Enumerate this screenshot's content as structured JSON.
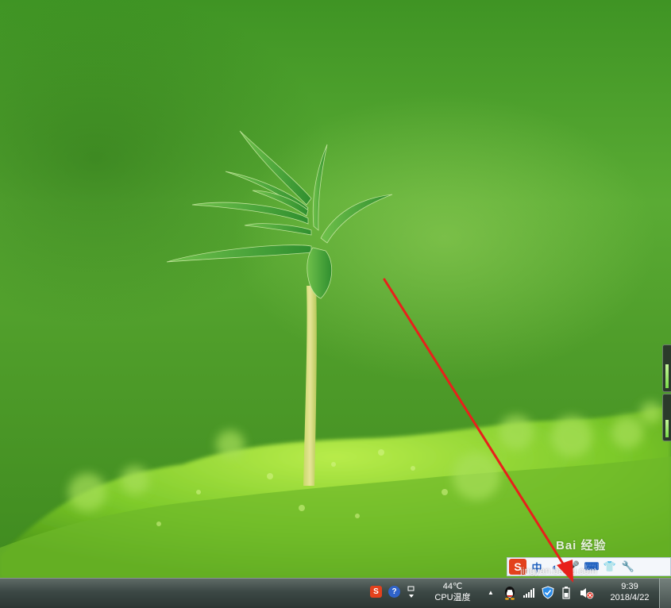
{
  "watermark": {
    "logo": "Bai 经验",
    "url": "jingyan.baidu.com"
  },
  "ime_toolbar": {
    "logo_label": "S",
    "mode_label": "中",
    "punct_label": "◐",
    "mic_label": "🎤",
    "keyboard_label": "⌨",
    "skin_label": "👕",
    "tools_label": "🔧"
  },
  "taskbar": {
    "tray": {
      "sogou_label": "S",
      "help_label": "?",
      "cpu_temp": "44℃",
      "cpu_label": "CPU温度",
      "expand_label": "▲",
      "clock_time": "9:39",
      "clock_date": "2018/4/22"
    }
  },
  "colors": {
    "annotation_arrow": "#e8201b",
    "ime_accent": "#1d5fbf",
    "sogou_orange": "#e3411d"
  }
}
